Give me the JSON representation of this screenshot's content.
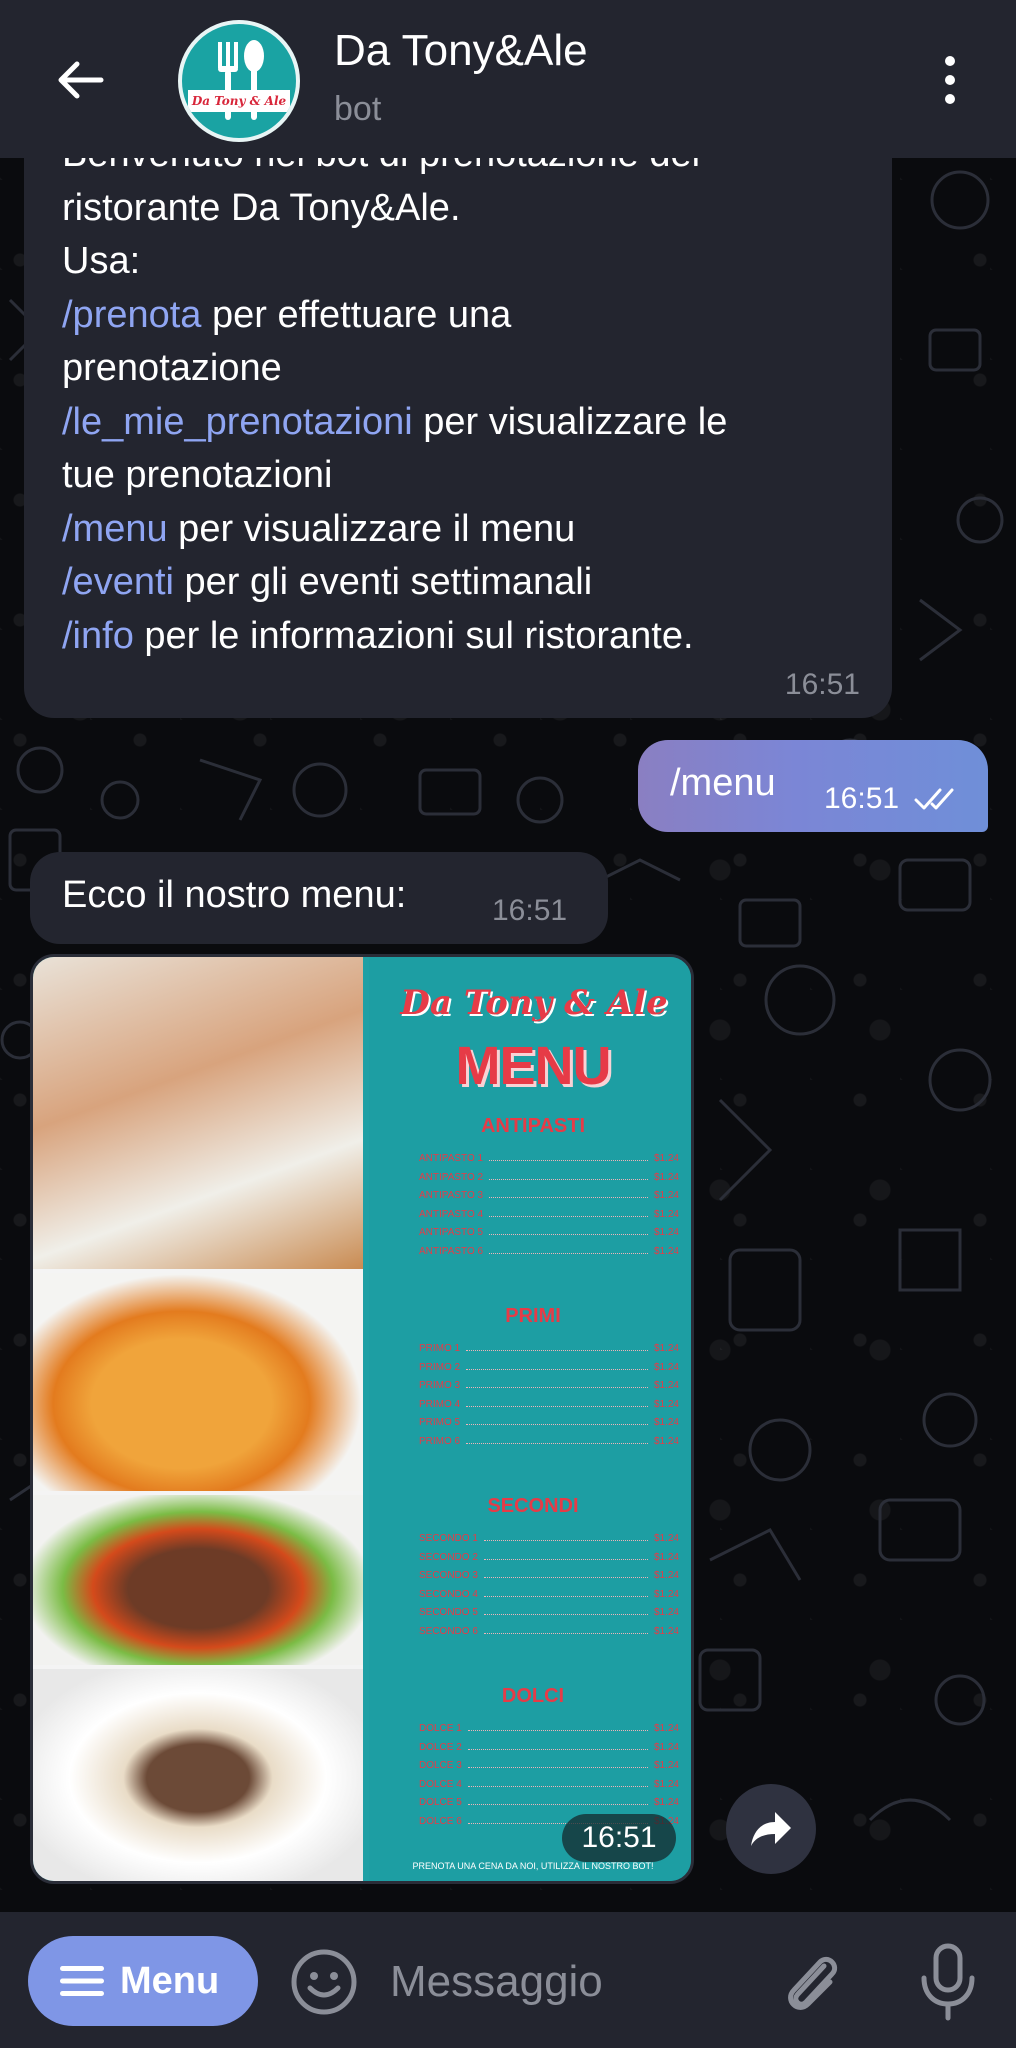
{
  "header": {
    "title": "Da Tony&Ale",
    "subtitle": "bot",
    "avatar_logo_text": "Da Tony & Ale"
  },
  "messages": [
    {
      "type": "incoming",
      "segments": [
        {
          "text": "Benvenuto nel bot di prenotazione del\nristorante Da Tony&Ale.\nUsa:\n",
          "cmd": false
        },
        {
          "text": "/prenota",
          "cmd": true
        },
        {
          "text": " per effettuare una\nprenotazione\n",
          "cmd": false
        },
        {
          "text": "/le_mie_prenotazioni",
          "cmd": true
        },
        {
          "text": " per visualizzare le\ntue prenotazioni\n",
          "cmd": false
        },
        {
          "text": "/menu",
          "cmd": true
        },
        {
          "text": " per visualizzare il menu\n",
          "cmd": false
        },
        {
          "text": "/eventi",
          "cmd": true
        },
        {
          "text": " per gli eventi settimanali\n",
          "cmd": false
        },
        {
          "text": "/info",
          "cmd": true
        },
        {
          "text": " per le informazioni sul ristorante.",
          "cmd": false
        }
      ],
      "time": "16:51"
    },
    {
      "type": "outgoing",
      "text": "/menu",
      "time": "16:51",
      "status": "read-double-check-icon"
    },
    {
      "type": "incoming",
      "text": "Ecco il nostro menu:",
      "time": "16:51"
    },
    {
      "type": "photo",
      "time": "16:51"
    }
  ],
  "menu_image": {
    "brand": "Da Tony & Ale",
    "title": "MENU",
    "sections": [
      {
        "name": "ANTIPASTI",
        "items": [
          {
            "label": "ANTIPASTO 1",
            "price": "$1.24"
          },
          {
            "label": "ANTIPASTO 2",
            "price": "$1.24"
          },
          {
            "label": "ANTIPASTO 3",
            "price": "$1.24"
          },
          {
            "label": "ANTIPASTO 4",
            "price": "$1.24"
          },
          {
            "label": "ANTIPASTO 5",
            "price": "$1.24"
          },
          {
            "label": "ANTIPASTO 6",
            "price": "$1.24"
          }
        ]
      },
      {
        "name": "PRIMI",
        "items": [
          {
            "label": "PRIMO 1",
            "price": "$1.24"
          },
          {
            "label": "PRIMO 2",
            "price": "$1.24"
          },
          {
            "label": "PRIMO 3",
            "price": "$1.24"
          },
          {
            "label": "PRIMO 4",
            "price": "$1.24"
          },
          {
            "label": "PRIMO 5",
            "price": "$1.24"
          },
          {
            "label": "PRIMO 6",
            "price": "$1.24"
          }
        ]
      },
      {
        "name": "SECONDI",
        "items": [
          {
            "label": "SECONDO 1",
            "price": "$1.24"
          },
          {
            "label": "SECONDO 2",
            "price": "$1.24"
          },
          {
            "label": "SECONDO 3",
            "price": "$1.24"
          },
          {
            "label": "SECONDO 4",
            "price": "$1.24"
          },
          {
            "label": "SECONDO 5",
            "price": "$1.24"
          },
          {
            "label": "SECONDO 6",
            "price": "$1.24"
          }
        ]
      },
      {
        "name": "DOLCI",
        "items": [
          {
            "label": "DOLCE 1",
            "price": "$1.24"
          },
          {
            "label": "DOLCE 2",
            "price": "$1.24"
          },
          {
            "label": "DOLCE 3",
            "price": "$1.24"
          },
          {
            "label": "DOLCE 4",
            "price": "$1.24"
          },
          {
            "label": "DOLCE 5",
            "price": "$1.24"
          },
          {
            "label": "DOLCE 6",
            "price": "$1.24"
          }
        ]
      }
    ],
    "footer": "PRENOTA UNA CENA DA NOI, UTILIZZA IL NOSTRO BOT!"
  },
  "composer": {
    "menu_button_label": "Menu",
    "input_placeholder": "Messaggio"
  },
  "colors": {
    "header_bg": "#23252f",
    "incoming_bubble": "#23252f",
    "command_link": "#8fa5f2",
    "outgoing_bubble_start": "#8a7fc2",
    "outgoing_bubble_end": "#6f8fd8",
    "menu_button": "#7f96e6",
    "menu_image_teal": "#1d9ea3",
    "menu_image_red": "#e63b47"
  },
  "icons": {
    "back": "arrow-left-icon",
    "more": "more-vertical-icon",
    "share": "share-forward-icon",
    "emoji": "smile-icon",
    "attach": "paperclip-icon",
    "mic": "microphone-icon",
    "menu": "hamburger-icon"
  }
}
